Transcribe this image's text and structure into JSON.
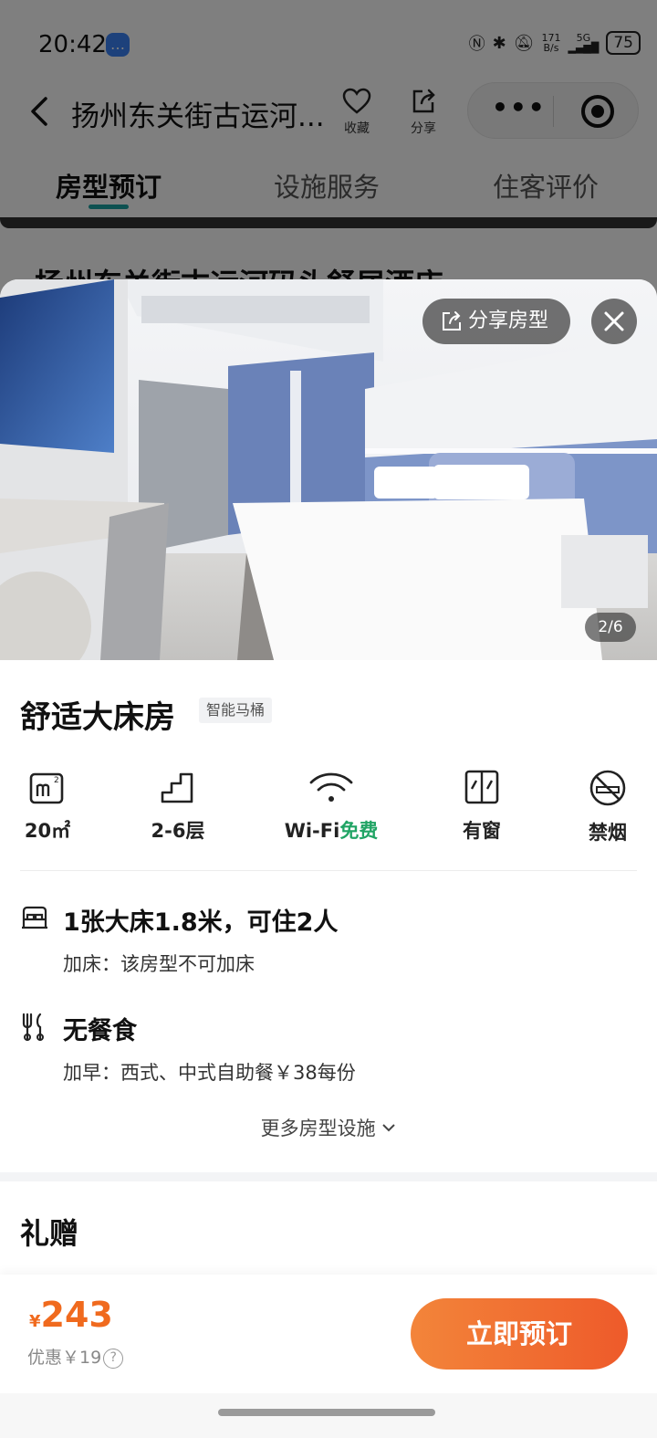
{
  "status_bar": {
    "time": "20:42",
    "net_speed_top": "171",
    "net_speed_bottom": "B/s",
    "network": "5G",
    "battery": "75"
  },
  "nav": {
    "title": "扬州东关街古运河...",
    "favorite_label": "收藏",
    "share_label": "分享"
  },
  "tabs": [
    {
      "label": "房型预订",
      "active": true
    },
    {
      "label": "设施服务",
      "active": false
    },
    {
      "label": "住客评价",
      "active": false
    }
  ],
  "hotel_name_peek": "扬州东关街古运河码头舒居酒店",
  "sheet": {
    "share_room_label": "分享房型",
    "photo_counter": "2/6",
    "room_title": "舒适大床房",
    "room_tag": "智能马桶",
    "facilities": [
      {
        "icon": "area-icon",
        "label": "20㎡"
      },
      {
        "icon": "floor-icon",
        "label": "2-6层"
      },
      {
        "icon": "wifi-icon",
        "label": "Wi-Fi",
        "label_highlight": "免费"
      },
      {
        "icon": "window-icon",
        "label": "有窗"
      },
      {
        "icon": "no-smoking-icon",
        "label": "禁烟"
      }
    ],
    "bed": {
      "main": "1张大床1.8米，可住2人",
      "sub": "加床：该房型不可加床"
    },
    "meal": {
      "main": "无餐食",
      "sub": "加早：西式、中式自助餐￥38每份"
    },
    "more_label": "更多房型设施",
    "gift_title": "礼赠"
  },
  "bottom_bar": {
    "currency": "¥",
    "price": "243",
    "discount": "优惠￥19",
    "book_label": "立即预订"
  },
  "colors": {
    "accent_orange": "#f06a1e",
    "free_green": "#20a464",
    "tab_underline": "#1aa3a3"
  }
}
